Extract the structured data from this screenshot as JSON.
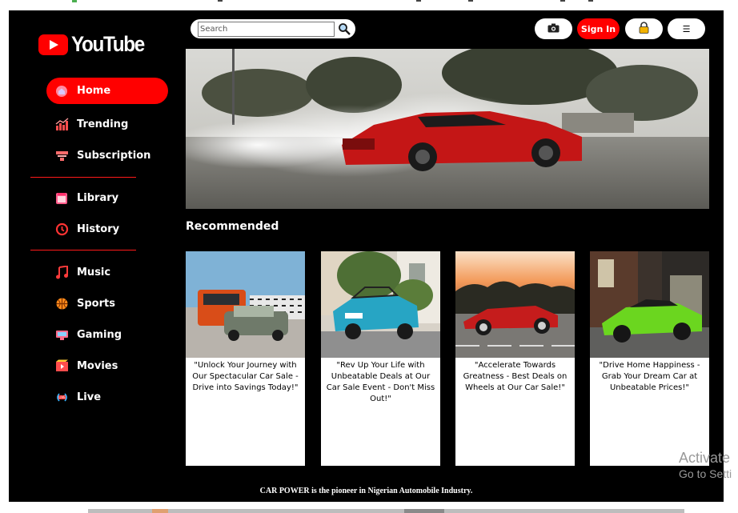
{
  "brand": {
    "name": "YouTube"
  },
  "sidebar": {
    "items": [
      {
        "label": "Home",
        "icon": "home-icon",
        "active": true
      },
      {
        "label": "Trending",
        "icon": "trending-icon"
      },
      {
        "label": "Subscription",
        "icon": "subscription-icon"
      },
      {
        "label": "Library",
        "icon": "library-icon"
      },
      {
        "label": "History",
        "icon": "history-icon"
      },
      {
        "label": "Music",
        "icon": "music-icon"
      },
      {
        "label": "Sports",
        "icon": "sports-icon"
      },
      {
        "label": "Gaming",
        "icon": "gaming-icon"
      },
      {
        "label": "Movies",
        "icon": "movies-icon"
      },
      {
        "label": "Live",
        "icon": "live-icon"
      }
    ]
  },
  "header": {
    "search": {
      "placeholder": "Search",
      "value": ""
    },
    "sign_in_label": "Sign In",
    "camera_icon": "camera-icon",
    "lock_icon": "lock-icon",
    "menu_label": "☰"
  },
  "main": {
    "section_title": "Recommended",
    "cards": [
      {
        "caption": "\"Unlock Your Journey with Our Spectacular Car Sale - Drive into Savings Today!\""
      },
      {
        "caption": "\"Rev Up Your Life with Unbeatable Deals at Our Car Sale Event - Don't Miss Out!\""
      },
      {
        "caption": "\"Accelerate Towards Greatness - Best Deals on Wheels at Our Car Sale!\""
      },
      {
        "caption": "\"Drive Home Happiness - Grab Your Dream Car at Unbeatable Prices!\""
      }
    ]
  },
  "footer": {
    "text": "CAR POWER is the pioneer in Nigerian Automobile Industry."
  },
  "watermark": {
    "line1": "Activate",
    "line2": "Go to Setti"
  },
  "colors": {
    "accent": "#ff0000",
    "background": "#000000",
    "text": "#ffffff"
  }
}
